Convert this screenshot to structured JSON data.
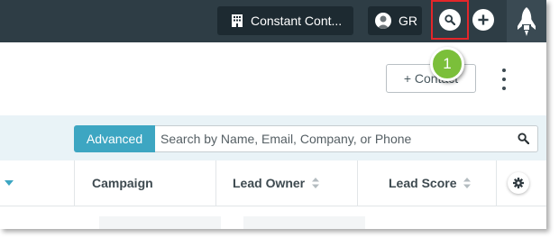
{
  "topbar": {
    "account_label": "Constant Cont...",
    "user_initials": "GR",
    "account_icon": "building-icon",
    "user_icon": "avatar-icon",
    "search_icon": "search-icon",
    "add_icon": "plus-icon",
    "logo_icon": "rocket-logo-icon",
    "highlight_color": "#e3262a"
  },
  "header": {
    "add_contact_label": "+ Contact",
    "callout_number": "1",
    "callout_color": "#7bbf3a",
    "more_icon": "more-vertical-icon"
  },
  "search": {
    "advanced_label": "Advanced",
    "placeholder": "Search by Name, Email, Company, or Phone",
    "accent_color": "#3da6c2"
  },
  "table": {
    "columns": [
      {
        "label": "Campaign"
      },
      {
        "label": "Lead Owner"
      },
      {
        "label": "Lead Score"
      }
    ],
    "settings_icon": "gear-icon"
  }
}
